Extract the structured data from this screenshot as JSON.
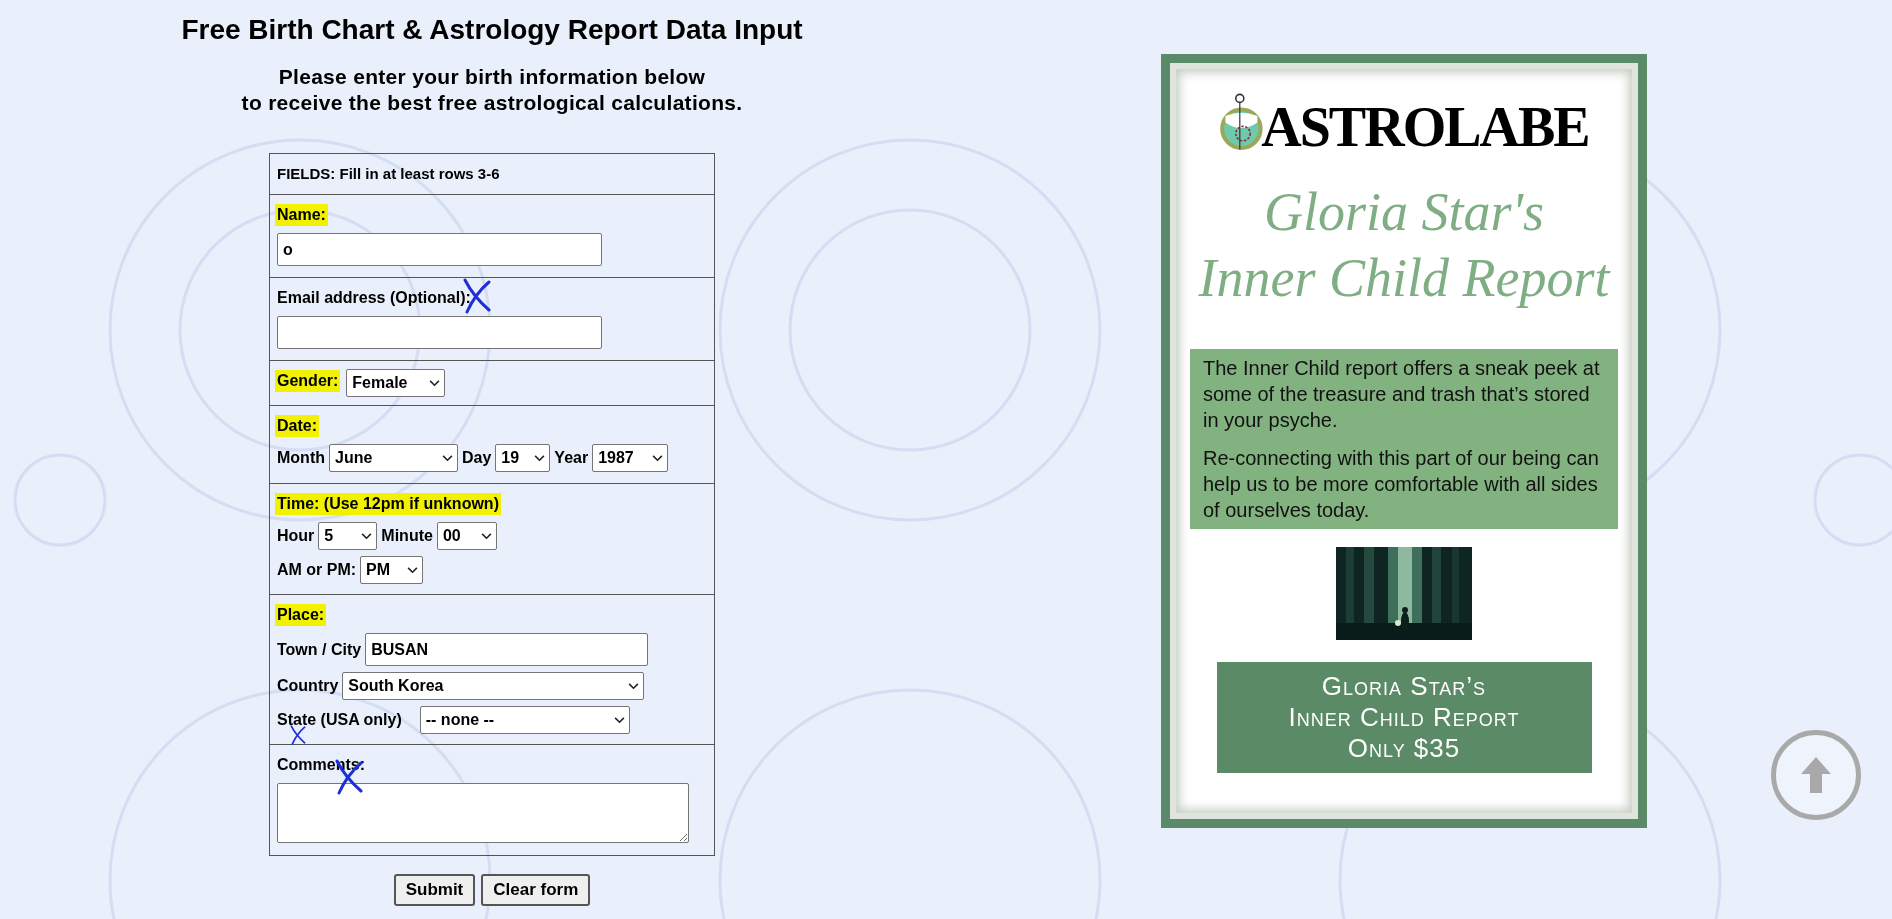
{
  "page": {
    "title": "Free Birth Chart & Astrology Report Data Input",
    "subtitle": [
      "Please enter your birth information below",
      "to receive the best free astrological calculations."
    ]
  },
  "form": {
    "header": "FIELDS: Fill in at least rows 3-6",
    "sections": [
      {
        "label": "Name:",
        "highlighted": true,
        "crossed": false,
        "inline": false,
        "lines": [
          [
            {
              "kind": "input",
              "value": "o"
            }
          ]
        ]
      },
      {
        "label": "Email address (Optional):",
        "highlighted": false,
        "crossed": true,
        "inline": false,
        "lines": [
          [
            {
              "kind": "input"
            }
          ]
        ]
      },
      {
        "label": "Gender:",
        "highlighted": true,
        "crossed": false,
        "inline": true,
        "lines": [
          [
            {
              "kind": "select",
              "value": "Female"
            }
          ]
        ]
      },
      {
        "label": "Date:",
        "highlighted": true,
        "crossed": false,
        "inline": false,
        "lines": [
          [
            {
              "kind": "caption",
              "text": "Month",
              "crossed": false
            },
            {
              "kind": "select",
              "value": "June"
            },
            {
              "kind": "caption",
              "text": "Day",
              "crossed": false
            },
            {
              "kind": "select",
              "value": "19"
            },
            {
              "kind": "caption",
              "text": "Year",
              "crossed": false
            },
            {
              "kind": "select",
              "value": "1987"
            }
          ]
        ]
      },
      {
        "label": "Time: (Use 12pm if unknown)",
        "highlighted": true,
        "crossed": false,
        "inline": false,
        "lines": [
          [
            {
              "kind": "caption",
              "text": "Hour",
              "crossed": false
            },
            {
              "kind": "select",
              "value": "5"
            },
            {
              "kind": "caption",
              "text": "Minute",
              "crossed": false
            },
            {
              "kind": "select",
              "value": "00"
            }
          ],
          [
            {
              "kind": "caption",
              "text": "AM or PM:",
              "crossed": false
            },
            {
              "kind": "select",
              "value": "PM"
            }
          ]
        ]
      },
      {
        "label": "Place:",
        "highlighted": true,
        "crossed": false,
        "inline": false,
        "lines": [
          [
            {
              "kind": "caption",
              "text": "Town / City",
              "crossed": false
            },
            {
              "kind": "input",
              "value": "BUSAN"
            }
          ],
          [
            {
              "kind": "caption",
              "text": "Country",
              "crossed": false
            },
            {
              "kind": "select",
              "value": "South Korea"
            }
          ],
          [
            {
              "kind": "caption",
              "text": "State (USA only)",
              "crossed": true
            },
            {
              "kind": "select",
              "value": "-- none --"
            }
          ]
        ]
      },
      {
        "label": "Comments:",
        "highlighted": false,
        "crossed": true,
        "inline": false,
        "lines": [
          [
            {
              "kind": "textarea"
            }
          ]
        ]
      }
    ],
    "buttons": [
      "Submit",
      "Clear form"
    ]
  },
  "ad": {
    "logo": "ASTROLABE",
    "title_lines": [
      "Gloria Star's",
      "Inner Child Report"
    ],
    "paragraphs": [
      "The Inner Child report offers a sneak peek at some of the treasure and trash that’s stored in your psyche.",
      "Re-connecting with this part of our being can help us to be more comfortable with all sides of ourselves today."
    ],
    "image": {
      "kind": "picture"
    },
    "cta_lines": [
      "Gloria Star’s",
      "Inner Child Report",
      "Only $35"
    ]
  }
}
